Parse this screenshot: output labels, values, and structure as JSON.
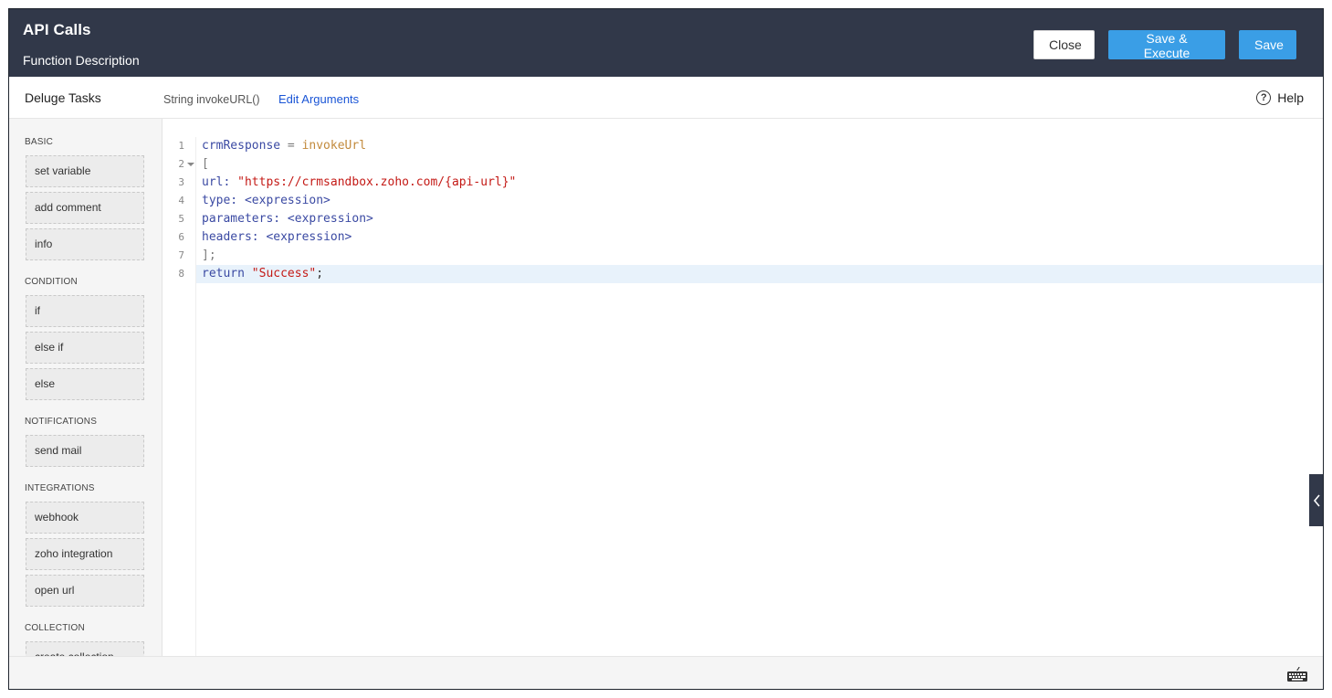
{
  "header": {
    "title": "API Calls",
    "subtitle": "Function Description",
    "close_label": "Close",
    "save_execute_label": "Save & Execute",
    "save_label": "Save",
    "primary_color": "#3a9ee6",
    "bg_color": "#313849"
  },
  "subbar": {
    "left_title": "Deluge Tasks",
    "signature": "String invokeURL()",
    "edit_arguments": "Edit Arguments",
    "help_label": "Help",
    "help_icon": "question-circle-icon"
  },
  "sidebar": {
    "sections": [
      {
        "title": "BASIC",
        "items": [
          "set variable",
          "add comment",
          "info"
        ]
      },
      {
        "title": "CONDITION",
        "items": [
          "if",
          "else if",
          "else"
        ]
      },
      {
        "title": "NOTIFICATIONS",
        "items": [
          "send mail"
        ]
      },
      {
        "title": "INTEGRATIONS",
        "items": [
          "webhook",
          "zoho integration",
          "open url"
        ]
      },
      {
        "title": "COLLECTION",
        "items": [
          "create collection"
        ]
      }
    ]
  },
  "editor": {
    "line_numbers": [
      "1",
      "2",
      "3",
      "4",
      "5",
      "6",
      "7",
      "8"
    ],
    "fold_line": 2,
    "active_line": 8,
    "lines": [
      [
        {
          "t": "crmResponse",
          "c": "var"
        },
        {
          "t": " = ",
          "c": "op"
        },
        {
          "t": "invokeUrl",
          "c": "fn"
        }
      ],
      [
        {
          "t": "[",
          "c": "op"
        }
      ],
      [
        {
          "t": "url: ",
          "c": "var"
        },
        {
          "t": "\"https://crmsandbox.zoho.com/{api-url}\"",
          "c": "str"
        }
      ],
      [
        {
          "t": "type: ",
          "c": "var"
        },
        {
          "t": "<expression>",
          "c": "kw"
        }
      ],
      [
        {
          "t": "parameters: ",
          "c": "var"
        },
        {
          "t": "<expression>",
          "c": "kw"
        }
      ],
      [
        {
          "t": "headers: ",
          "c": "var"
        },
        {
          "t": "<expression>",
          "c": "kw"
        }
      ],
      [
        {
          "t": "];",
          "c": "op"
        }
      ],
      [
        {
          "t": "return ",
          "c": "kw"
        },
        {
          "t": "\"Success\"",
          "c": "str"
        },
        {
          "t": ";",
          "c": "plain"
        }
      ]
    ]
  },
  "icons": {
    "collapse": "chevron-left-icon",
    "keyboard": "keyboard-icon"
  }
}
